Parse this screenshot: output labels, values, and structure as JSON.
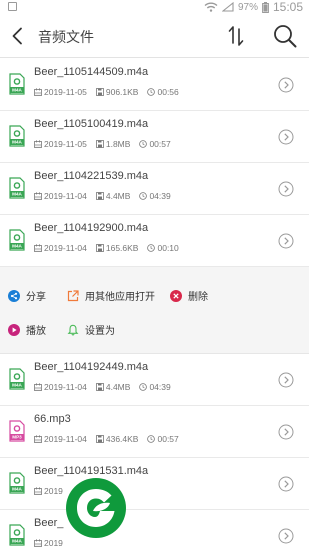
{
  "status_bar": {
    "battery": "97%",
    "time": "15:05"
  },
  "header": {
    "title": "音频文件"
  },
  "files_top": [
    {
      "name": "Beer_1105144509.m4a",
      "date": "2019-11-05",
      "size": "906.1KB",
      "duration": "00:56",
      "type": "M4A"
    },
    {
      "name": "Beer_1105100419.m4a",
      "date": "2019-11-05",
      "size": "1.8MB",
      "duration": "00:57",
      "type": "M4A"
    },
    {
      "name": "Beer_1104221539.m4a",
      "date": "2019-11-04",
      "size": "4.4MB",
      "duration": "04:39",
      "type": "M4A"
    },
    {
      "name": "Beer_1104192900.m4a",
      "date": "2019-11-04",
      "size": "165.6KB",
      "duration": "00:10",
      "type": "M4A"
    }
  ],
  "actions": {
    "share": "分享",
    "open_with": "用其他应用打开",
    "delete": "删除",
    "play": "播放",
    "set_as": "设置为"
  },
  "files_bottom": [
    {
      "name": "Beer_1104192449.m4a",
      "date": "2019-11-04",
      "size": "4.4MB",
      "duration": "04:39",
      "type": "M4A"
    },
    {
      "name": "66.mp3",
      "date": "2019-11-04",
      "size": "436.4KB",
      "duration": "00:57",
      "type": "MP3"
    },
    {
      "name": "Beer_1104191531.m4a",
      "date": "2019",
      "size": "",
      "duration": "",
      "type": "M4A"
    },
    {
      "name": "Beer_",
      "date": "2019",
      "size": "",
      "duration": "",
      "type": "M4A"
    }
  ],
  "colors": {
    "m4a_icon": "#3aa655",
    "mp3_icon": "#d64aa0",
    "share": "#1a7fd6",
    "open_with": "#f07a3a",
    "delete": "#d8284b",
    "play": "#c7247c",
    "set_as": "#4cbb5a",
    "logo": "#0f9a3c"
  },
  "icons": {
    "back": "chevron-left-icon",
    "sort": "sort-icon",
    "search": "search-icon",
    "date": "calendar-icon",
    "size": "save-icon",
    "duration": "clock-icon",
    "row_action": "chevron-right-circle-icon"
  }
}
